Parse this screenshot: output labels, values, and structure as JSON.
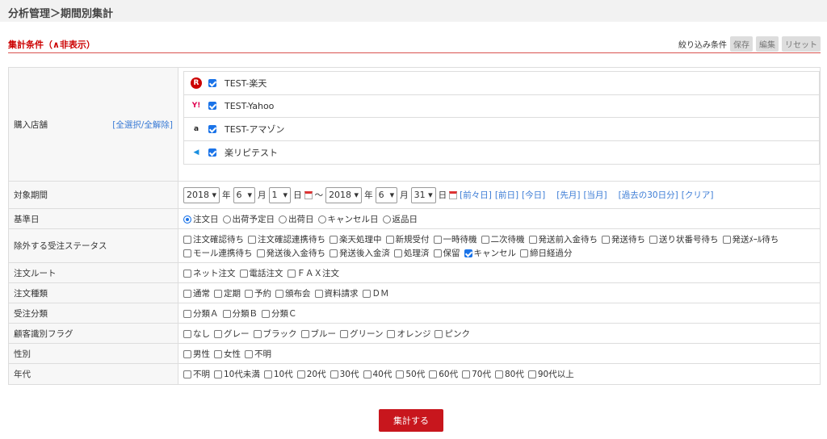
{
  "header": {
    "breadcrumb": "分析管理＞期間別集計"
  },
  "section": {
    "title": "集計条件（∧非表示）",
    "filter_label": "絞り込み条件",
    "save": "保存",
    "edit": "編集",
    "reset": "リセット"
  },
  "shops": {
    "label": "購入店舗",
    "select_all": "[全選択/全解除]",
    "items": [
      {
        "name": "TEST-楽天",
        "icon": "rakuten-icon",
        "checked": true
      },
      {
        "name": "TEST-Yahoo",
        "icon": "yahoo-icon",
        "checked": true
      },
      {
        "name": "TEST-アマゾン",
        "icon": "amazon-icon",
        "checked": true
      },
      {
        "name": "楽リピテスト",
        "icon": "arrow-icon",
        "checked": true
      }
    ]
  },
  "period": {
    "label": "対象期間",
    "from_year": "2018",
    "from_month": "6",
    "from_day": "1",
    "to_year": "2018",
    "to_month": "6",
    "to_day": "31",
    "year": "年",
    "month": "月",
    "day": "日",
    "tilde": "～",
    "links": [
      "[前々日]",
      "[前日]",
      "[今日]",
      "[先月]",
      "[当月]",
      "[過去の30日分]",
      "[クリア]"
    ]
  },
  "base_date": {
    "label": "基準日",
    "options": [
      "注文日",
      "出荷予定日",
      "出荷日",
      "キャンセル日",
      "返品日"
    ],
    "selected": 0
  },
  "exclude": {
    "label": "除外する受注ステータス",
    "options": [
      "注文確認待ち",
      "注文確認連携待ち",
      "楽天処理中",
      "新規受付",
      "一時待機",
      "二次待機",
      "発送前入金待ち",
      "発送待ち",
      "送り状番号待ち",
      "発送ﾒｰﾙ待ち",
      "モール連携待ち",
      "発送後入金待ち",
      "発送後入金済",
      "処理済",
      "保留",
      "キャンセル",
      "締日経過分"
    ],
    "checked": [
      15
    ]
  },
  "route": {
    "label": "注文ルート",
    "options": [
      "ネット注文",
      "電話注文",
      "ＦＡＸ注文"
    ]
  },
  "order_type": {
    "label": "注文種類",
    "options": [
      "通常",
      "定期",
      "予約",
      "頒布会",
      "資料請求",
      "ＤＭ"
    ]
  },
  "category": {
    "label": "受注分類",
    "options": [
      "分類Ａ",
      "分類Ｂ",
      "分類Ｃ"
    ]
  },
  "customer_flag": {
    "label": "顧客識別フラグ",
    "options": [
      "なし",
      "グレー",
      "ブラック",
      "ブルー",
      "グリーン",
      "オレンジ",
      "ピンク"
    ]
  },
  "gender": {
    "label": "性別",
    "options": [
      "男性",
      "女性",
      "不明"
    ]
  },
  "age": {
    "label": "年代",
    "options": [
      "不明",
      "10代未満",
      "10代",
      "20代",
      "30代",
      "40代",
      "50代",
      "60代",
      "70代",
      "80代",
      "90代以上"
    ]
  },
  "submit": "集計する",
  "colors": {
    "accent": "#c8161d",
    "link": "#3a7bd5"
  }
}
